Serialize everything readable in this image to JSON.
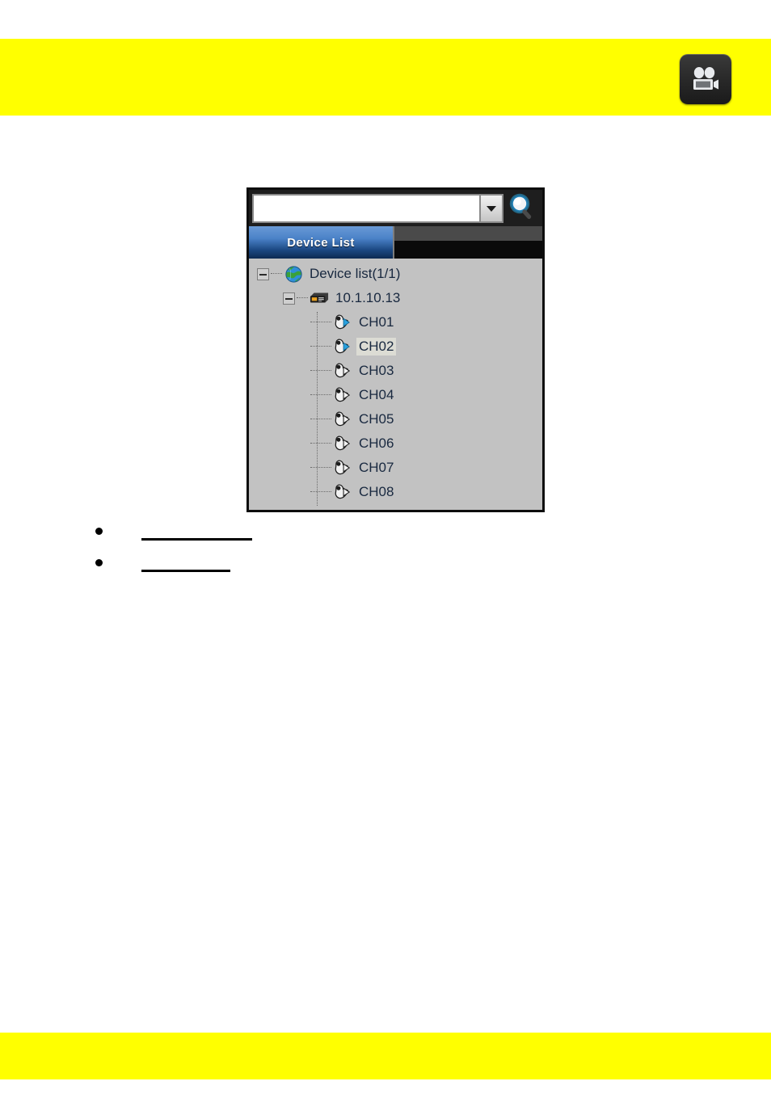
{
  "page": {
    "background_color": "#ffffff",
    "banner_color": "#ffff00"
  },
  "header": {
    "banner_color": "#ffff00",
    "icon": {
      "name": "video-camera-icon",
      "title": "Video Camera",
      "background_color": "#2b2b2b",
      "glyph_color": "#e8eaed"
    }
  },
  "device_panel": {
    "border_color": "#0d0d0d",
    "background_color": "#c2c2c2",
    "search": {
      "value": "",
      "placeholder": "",
      "dropdown_icon": "chevron-down-icon",
      "search_icon": "magnifier-icon",
      "search_icon_color": "#29a9e1"
    },
    "tabs": [
      {
        "label": "Device List",
        "active": true,
        "accent_color": "#4a82c8"
      }
    ],
    "tree": [
      {
        "label": "Device list(1/1)",
        "level": 0,
        "icon": "globe-icon",
        "expanded": true,
        "selected": false
      },
      {
        "label": "10.1.10.13",
        "level": 1,
        "icon": "dvr-device-icon",
        "expanded": true,
        "selected": false
      },
      {
        "label": "CH01",
        "level": 2,
        "icon": "camera-playing-icon",
        "streaming": true,
        "selected": false
      },
      {
        "label": "CH02",
        "level": 2,
        "icon": "camera-playing-icon",
        "streaming": true,
        "selected": true
      },
      {
        "label": "CH03",
        "level": 2,
        "icon": "camera-idle-icon",
        "streaming": false,
        "selected": false
      },
      {
        "label": "CH04",
        "level": 2,
        "icon": "camera-idle-icon",
        "streaming": false,
        "selected": false
      },
      {
        "label": "CH05",
        "level": 2,
        "icon": "camera-idle-icon",
        "streaming": false,
        "selected": false
      },
      {
        "label": "CH06",
        "level": 2,
        "icon": "camera-idle-icon",
        "streaming": false,
        "selected": false
      },
      {
        "label": "CH07",
        "level": 2,
        "icon": "camera-idle-icon",
        "streaming": false,
        "selected": false
      },
      {
        "label": "CH08",
        "level": 2,
        "icon": "camera-idle-icon",
        "streaming": false,
        "selected": false
      }
    ]
  },
  "bullets": [
    {
      "text": ""
    },
    {
      "text": ""
    }
  ],
  "footer": {
    "banner_color": "#ffff00"
  }
}
